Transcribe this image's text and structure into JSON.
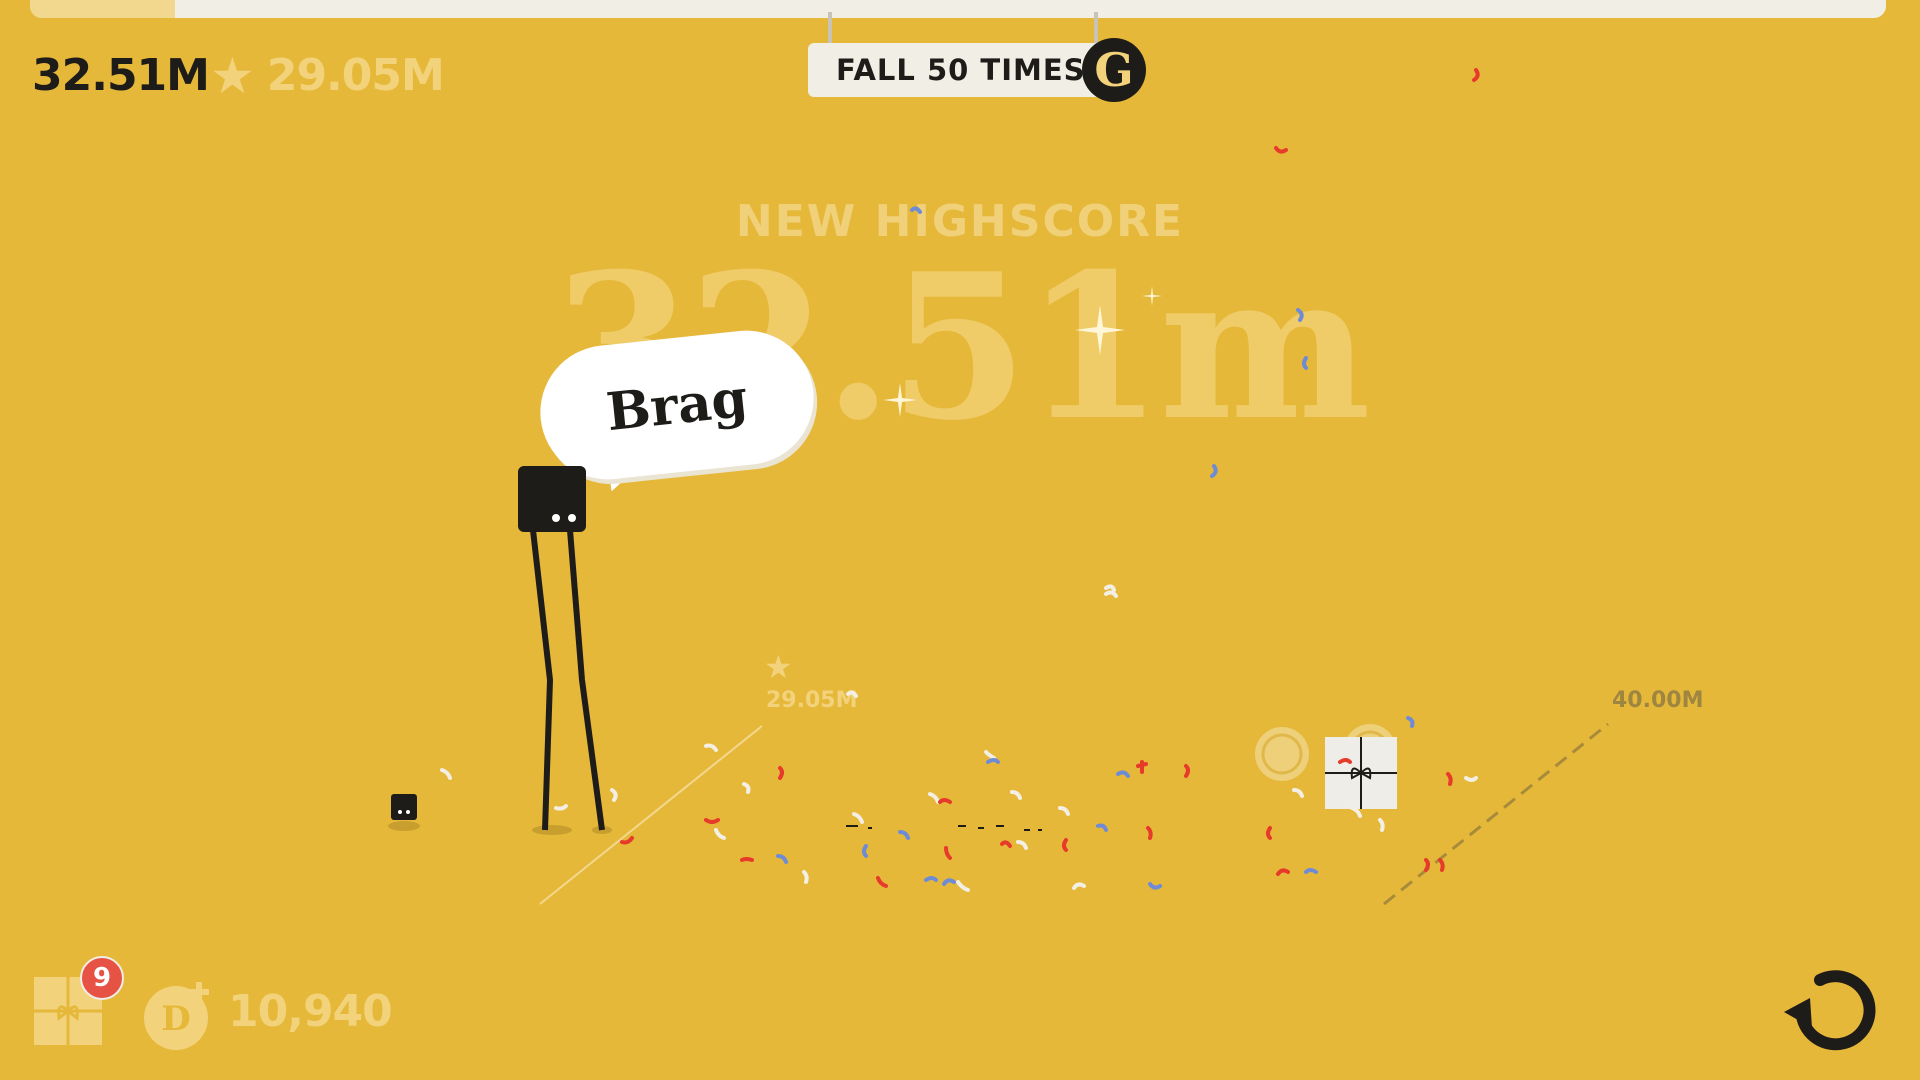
{
  "hud": {
    "current_distance": "32.51M",
    "best_distance": "29.05M",
    "progress_fraction": 0.078
  },
  "challenge": {
    "text": "FALL 50 TIMES",
    "badge": "G"
  },
  "result": {
    "title": "NEW HIGHSCORE",
    "value": "32.51m"
  },
  "brag": {
    "label": "Brag"
  },
  "track": {
    "best_marker": "29.05M",
    "goal_marker": "40.00M"
  },
  "bottom": {
    "gift_count": "9",
    "coins": "10,940"
  },
  "icons": {
    "star": "star-icon",
    "gift": "gift-icon",
    "coin": "coin-plus-icon",
    "restart": "restart-arrow-icon",
    "present": "present-box-icon"
  },
  "colors": {
    "background": "#E6B83A",
    "dark": "#1E1C19",
    "muted": "#F2D27A",
    "badge": "#E65243"
  }
}
